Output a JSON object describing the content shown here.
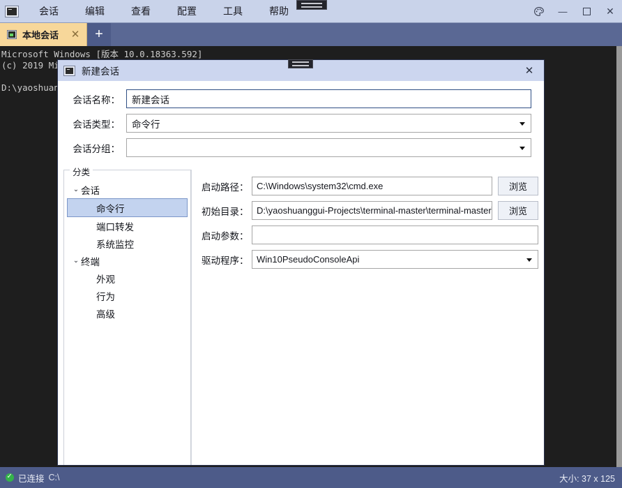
{
  "window": {
    "app_icon": "terminal-icon",
    "menus": [
      "会话",
      "编辑",
      "查看",
      "配置",
      "工具",
      "帮助"
    ],
    "controls": {
      "theme": "palette-icon",
      "minimize": "—",
      "maximize": "☐",
      "close": "✕"
    }
  },
  "tabs": {
    "items": [
      {
        "label": "本地会话",
        "close": "✕",
        "active": true
      }
    ],
    "add_label": "+"
  },
  "terminal": {
    "lines": [
      "Microsoft Windows [版本 10.0.18363.592]",
      "(c) 2019 Mi",
      "",
      "D:\\yaoshuan"
    ]
  },
  "statusbar": {
    "connection": "已连接",
    "path": "C:\\",
    "size": "大小: 37 x 125"
  },
  "dialog": {
    "title": "新建会话",
    "close_label": "✕",
    "fields": [
      {
        "label": "会话名称：",
        "value": "新建会话",
        "type": "text",
        "focused": true
      },
      {
        "label": "会话类型：",
        "value": "命令行",
        "type": "combo",
        "focused": false
      },
      {
        "label": "会话分组：",
        "value": "",
        "type": "combo",
        "focused": false
      }
    ],
    "categories": {
      "legend": "分类",
      "groups": [
        {
          "label": "会话",
          "chevron": "⌄",
          "items": [
            {
              "label": "命令行",
              "selected": true
            },
            {
              "label": "端口转发",
              "selected": false
            },
            {
              "label": "系统监控",
              "selected": false
            }
          ]
        },
        {
          "label": "终端",
          "chevron": "⌄",
          "items": [
            {
              "label": "外观",
              "selected": false
            },
            {
              "label": "行为",
              "selected": false
            },
            {
              "label": "高级",
              "selected": false
            }
          ]
        }
      ]
    },
    "detail": [
      {
        "label": "启动路径：",
        "value": "C:\\Windows\\system32\\cmd.exe",
        "type": "text",
        "browse": "浏览"
      },
      {
        "label": "初始目录：",
        "value": "D:\\yaoshuanggui-Projects\\terminal-master\\terminal-master\\",
        "type": "text",
        "browse": "浏览"
      },
      {
        "label": "启动参数：",
        "value": "",
        "type": "text",
        "browse": ""
      },
      {
        "label": "驱动程序：",
        "value": "Win10PseudoConsoleApi",
        "type": "combo",
        "browse": ""
      }
    ]
  }
}
